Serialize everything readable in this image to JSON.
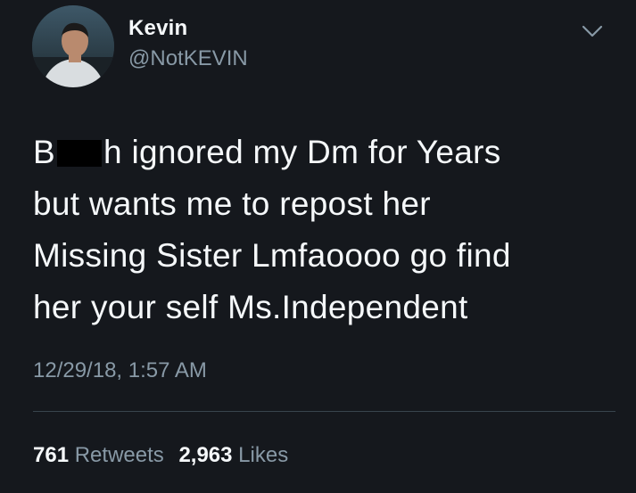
{
  "user": {
    "display_name": "Kevin",
    "handle": "@NotKEVIN"
  },
  "icons": {
    "more": "chevron-down-icon"
  },
  "tweet": {
    "line1_start": "B",
    "line1_end": "h ignored my Dm for Years",
    "line2": "but wants me to repost her",
    "line3": "Missing Sister Lmfaoooo go find",
    "line4": "her your self Ms.Independent",
    "timestamp": "12/29/18, 1:57 AM"
  },
  "stats": {
    "retweets_count": "761",
    "retweets_label": "Retweets",
    "likes_count": "2,963",
    "likes_label": "Likes"
  },
  "colors": {
    "background": "#15181d",
    "primary_text": "#f5f8fa",
    "secondary_text": "#8899a6",
    "divider": "#38444d"
  }
}
